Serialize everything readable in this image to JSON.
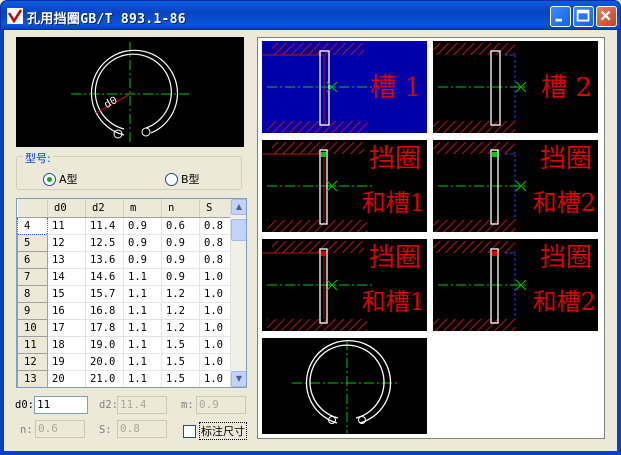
{
  "window": {
    "title": "孔用挡圈GB/T 893.1-86"
  },
  "type_group": {
    "label": "型号:",
    "options": [
      "A型",
      "B型"
    ],
    "selected": "A型"
  },
  "preview": {
    "dim_label": "d0"
  },
  "table": {
    "columns": [
      "",
      "d0",
      "d2",
      "m",
      "n",
      "S"
    ],
    "rows": [
      [
        "4",
        "11",
        "11.4",
        "0.9",
        "0.6",
        "0.8"
      ],
      [
        "5",
        "12",
        "12.5",
        "0.9",
        "0.9",
        "0.8"
      ],
      [
        "6",
        "13",
        "13.6",
        "0.9",
        "0.9",
        "0.8"
      ],
      [
        "7",
        "14",
        "14.6",
        "1.1",
        "0.9",
        "1.0"
      ],
      [
        "8",
        "15",
        "15.7",
        "1.1",
        "1.2",
        "1.0"
      ],
      [
        "9",
        "16",
        "16.8",
        "1.1",
        "1.2",
        "1.0"
      ],
      [
        "10",
        "17",
        "17.8",
        "1.1",
        "1.2",
        "1.0"
      ],
      [
        "11",
        "18",
        "19.0",
        "1.1",
        "1.5",
        "1.0"
      ],
      [
        "12",
        "19",
        "20.0",
        "1.1",
        "1.5",
        "1.0"
      ],
      [
        "13",
        "20",
        "21.0",
        "1.1",
        "1.5",
        "1.0"
      ]
    ],
    "selected_row": "4"
  },
  "fields": {
    "d0_label": "d0:",
    "d0_value": "11",
    "d2_label": "d2:",
    "d2_value": "11.4",
    "m_label": "m:",
    "m_value": "0.9",
    "n_label": "n:",
    "n_value": "0.6",
    "s_label": "S:",
    "s_value": "0.8"
  },
  "annotate_checkbox": {
    "label": "标注尺寸",
    "checked": false
  },
  "tiles": [
    {
      "line1": "槽 1",
      "line2": ""
    },
    {
      "line1": "槽 2",
      "line2": ""
    },
    {
      "line1": "挡圈",
      "line2": "和槽1"
    },
    {
      "line1": "挡圈",
      "line2": "和槽2"
    },
    {
      "line1": "挡圈",
      "line2": "和槽1"
    },
    {
      "line1": "挡圈",
      "line2": "和槽2"
    }
  ],
  "colors": {
    "title_blue": "#0842c4",
    "tile_selected_bg": "#0000a8",
    "tile_bg": "#000000",
    "label_red": "#e00000",
    "center_green": "#00c800",
    "hatch_red": "#c01010"
  }
}
